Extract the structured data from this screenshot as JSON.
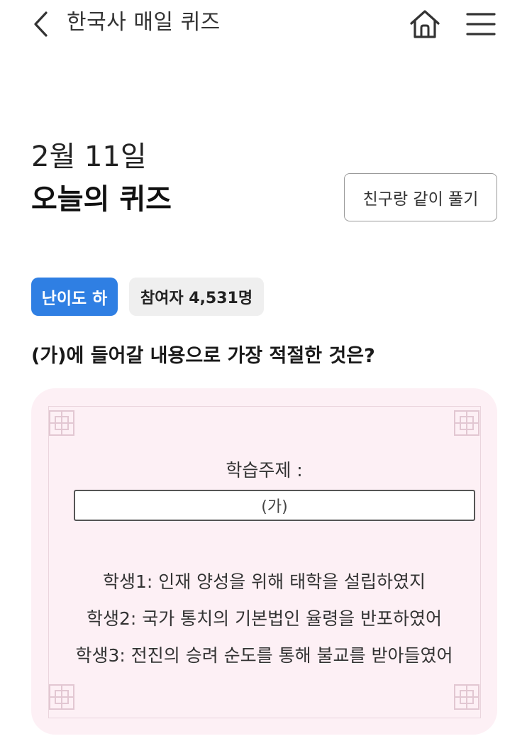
{
  "header": {
    "title": "한국사 매일 퀴즈",
    "back_icon": "chevron-left-icon",
    "home_icon": "home-icon",
    "menu_icon": "hamburger-menu-icon"
  },
  "quiz": {
    "date": "2월 11일",
    "title": "오늘의 퀴즈",
    "friend_button": "친구랑 같이 풀기",
    "difficulty": "난이도 하",
    "participants": "참여자 4,531명",
    "question": "(가)에 들어갈 내용으로 가장 적절한 것은?"
  },
  "card": {
    "topic_label": "학습주제 :",
    "answer_placeholder": "(가)",
    "students": [
      "학생1: 인재 양성을 위해 태학을 설립하였지",
      "학생2: 국가 통치의 기본법인 율령을 반포하였어",
      "학생3: 전진의 승려 순도를 통해 불교를 받아들였어"
    ]
  },
  "colors": {
    "accent": "#2f7fe3",
    "card_background": "#fdf0f5",
    "badge_gray": "#efefef"
  }
}
